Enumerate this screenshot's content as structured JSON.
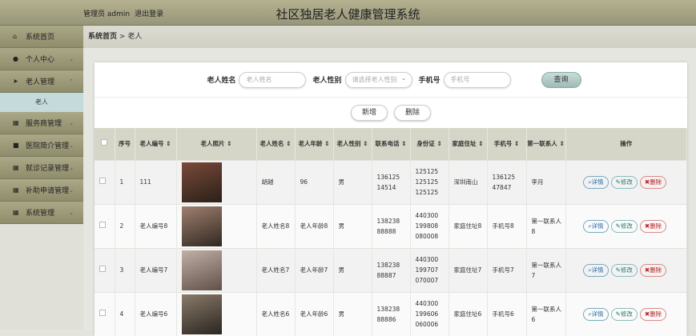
{
  "header": {
    "admin_label": "管理员 admin",
    "logout": "退出登录",
    "title": "社区独居老人健康管理系统"
  },
  "sidebar": {
    "items": [
      {
        "icon": "home-icon",
        "glyph": "⌂",
        "label": "系统首页",
        "chev": ""
      },
      {
        "icon": "user-icon",
        "glyph": "●",
        "label": "个人中心",
        "chev": "⌄"
      },
      {
        "icon": "send-icon",
        "glyph": "➤",
        "label": "老人管理",
        "chev": "⌃"
      }
    ],
    "sub": "老人",
    "items2": [
      {
        "icon": "grid-icon",
        "glyph": "▦",
        "label": "服务商管理",
        "chev": "⌄"
      },
      {
        "icon": "briefcase-icon",
        "glyph": "■",
        "label": "医院简介管理",
        "chev": "⌄"
      },
      {
        "icon": "grid-icon",
        "glyph": "▦",
        "label": "就诊记录管理",
        "chev": "⌄"
      },
      {
        "icon": "grid-icon",
        "glyph": "▦",
        "label": "补助申请管理",
        "chev": "⌄"
      },
      {
        "icon": "grid-icon",
        "glyph": "▦",
        "label": "系统管理",
        "chev": "⌄"
      }
    ]
  },
  "breadcrumb": {
    "home": "系统首页",
    "sep": ">",
    "current": "老人"
  },
  "search": {
    "name_label": "老人姓名",
    "name_ph": "老人姓名",
    "gender_label": "老人性别",
    "gender_ph": "请选择老人性别",
    "phone_label": "手机号",
    "phone_ph": "手机号",
    "query": "查询"
  },
  "actions": {
    "add": "新增",
    "delete": "删除"
  },
  "table": {
    "headers": [
      "序号",
      "老人编号 ⇕",
      "老人照片 ⇕",
      "老人姓名 ⇕",
      "老人年龄 ⇕",
      "老人性别 ⇕",
      "联系电话 ⇕",
      "身份证 ⇕",
      "家庭住址 ⇕",
      "手机号 ⇕",
      "第一联系人 ⇕",
      "操作"
    ],
    "rows": [
      [
        "1",
        "111",
        "",
        "胡越",
        "96",
        "男",
        "136125 14514",
        "125125 125125 125125",
        "深圳南山",
        "136125 47847",
        "李月"
      ],
      [
        "2",
        "老人编号8",
        "",
        "老人姓名8",
        "老人年龄8",
        "男",
        "138238 88888",
        "440300 199808 080008",
        "家庭住址8",
        "手机号8",
        "第一联系人8"
      ],
      [
        "3",
        "老人编号7",
        "",
        "老人姓名7",
        "老人年龄7",
        "男",
        "138238 88887",
        "440300 199707 070007",
        "家庭住址7",
        "手机号7",
        "第一联系人7"
      ],
      [
        "4",
        "老人编号6",
        "",
        "老人姓名6",
        "老人年龄6",
        "男",
        "138238 88886",
        "440300 199606 060006",
        "家庭住址6",
        "手机号6",
        "第一联系人6"
      ]
    ],
    "btn_detail": "详情",
    "btn_edit": "修改",
    "btn_del": "删除"
  }
}
